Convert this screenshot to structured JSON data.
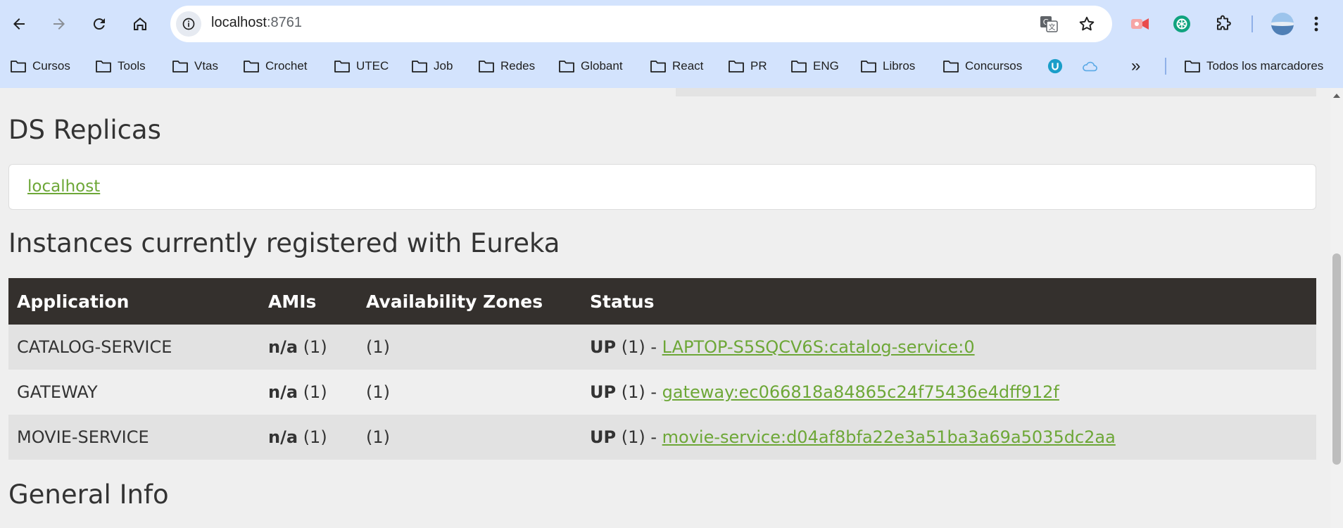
{
  "browser": {
    "url_host": "localhost",
    "url_port": ":8761",
    "bookmarks": [
      {
        "label": "Cursos"
      },
      {
        "label": "Tools"
      },
      {
        "label": "Vtas"
      },
      {
        "label": "Crochet"
      },
      {
        "label": "UTEC"
      },
      {
        "label": "Job"
      },
      {
        "label": "Redes"
      },
      {
        "label": "Globant"
      },
      {
        "label": "React"
      },
      {
        "label": "PR"
      },
      {
        "label": "ENG"
      },
      {
        "label": "Libros"
      },
      {
        "label": "Concursos"
      }
    ],
    "all_bookmarks_label": "Todos los marcadores",
    "overflow_label": "»"
  },
  "page": {
    "replicas_title": "DS Replicas",
    "replica_link": "localhost",
    "instances_title": "Instances currently registered with Eureka",
    "general_info_title": "General Info",
    "table": {
      "headers": [
        "Application",
        "AMIs",
        "Availability Zones",
        "Status"
      ],
      "rows": [
        {
          "application": "CATALOG-SERVICE",
          "amis_bold": "n/a",
          "amis_count": "(1)",
          "zones": "(1)",
          "status_bold": "UP",
          "status_count": "(1) -",
          "instance": "LAPTOP-S5SQCV6S:catalog-service:0"
        },
        {
          "application": "GATEWAY",
          "amis_bold": "n/a",
          "amis_count": "(1)",
          "zones": "(1)",
          "status_bold": "UP",
          "status_count": "(1) -",
          "instance": "gateway:ec066818a84865c24f75436e4dff912f"
        },
        {
          "application": "MOVIE-SERVICE",
          "amis_bold": "n/a",
          "amis_count": "(1)",
          "zones": "(1)",
          "status_bold": "UP",
          "status_count": "(1) -",
          "instance": "movie-service:d04af8bfa22e3a51ba3a69a5035dc2aa"
        }
      ]
    }
  },
  "colors": {
    "chrome_bg": "#d3e3fd",
    "link_green": "#6da737",
    "table_header_bg": "#34302d",
    "row_alt_bg": "#e2e2e2"
  }
}
